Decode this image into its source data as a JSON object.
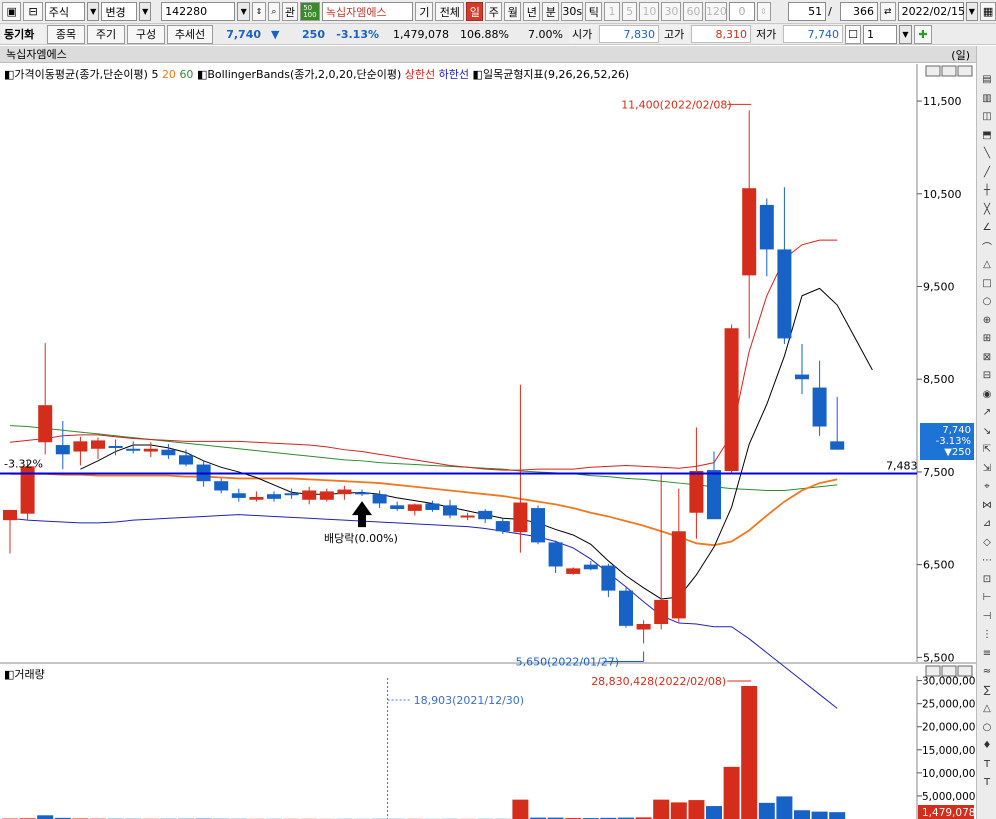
{
  "toolbar": {
    "market": "주식",
    "change": "변경",
    "code": "142280",
    "search_small": "관",
    "badge": "50\n100",
    "stock_name": "녹십자엠에스",
    "tab_gi": "기",
    "tab_all": "전체",
    "periods": [
      "일",
      "주",
      "월",
      "년",
      "분",
      "30s",
      "틱"
    ],
    "ticks": [
      "1",
      "5",
      "10",
      "30",
      "60",
      "120"
    ],
    "zero": "0",
    "count": "51",
    "slash": "/",
    "total": "366",
    "date": "2022/02/15"
  },
  "quote": {
    "sync": "동기화",
    "btn_item": "종목",
    "btn_period": "주기",
    "btn_compose": "구성",
    "btn_trend": "추세선",
    "price": "7,740",
    "change_arrow": "▼",
    "change": "250",
    "change_pct": "-3.13%",
    "volume": "1,479,078",
    "ratio": "106.88%",
    "turnover": "7.00%",
    "open_label": "시가",
    "open": "7,830",
    "high_label": "고가",
    "high": "8,310",
    "low_label": "저가",
    "low": "7,740",
    "panel_no": "1"
  },
  "title": {
    "name": "녹십자엠에스",
    "period": "(일)"
  },
  "price_legend": {
    "ma_label": "가격이동평균(종가,단순이평)",
    "ma5": "5",
    "ma20": "20",
    "ma60": "60",
    "bb_label": "BollingerBands(종가,2,0,20,단순이평)",
    "upper": "상한선",
    "lower": "하한선",
    "ichimoku": "일목균형지표(9,26,26,52,26)"
  },
  "volume_legend": {
    "label": "거래량"
  },
  "annotations": {
    "high": "11,400(2022/02/08)",
    "low": "5,650(2022/01/27)",
    "dividend": "배당락(0.00%)",
    "hline_pct": "-3.32%",
    "hline_value": "7,483",
    "vol_high": "28,830,428(2022/02/08)",
    "vol_mark": "18,903(2021/12/30)",
    "vol_last": "1,479,078"
  },
  "price_tag": {
    "price": "7,740",
    "pct": "-3.13%",
    "chg": "▼250"
  },
  "colors": {
    "up": "#d42d1b",
    "down": "#1762c7",
    "ma5": "#000000",
    "ma20": "#f07820",
    "ma60": "#2e8b2e",
    "bb_upper": "#d42020",
    "bb_lower": "#2020c0",
    "hline": "#0000dd"
  },
  "chart_data": [
    {
      "type": "candlestick",
      "title": "녹십자엠에스 (일)",
      "y_ticks": [
        "11,500",
        "10,500",
        "9,500",
        "8,500",
        "7,500",
        "6,500",
        "5,500"
      ],
      "ylim": [
        5450,
        11900
      ],
      "candles": [
        {
          "o": 6980,
          "h": 7050,
          "l": 6620,
          "c": 7090
        },
        {
          "o": 7050,
          "h": 7620,
          "l": 6980,
          "c": 7560
        },
        {
          "o": 7820,
          "h": 8890,
          "l": 7690,
          "c": 8220
        },
        {
          "o": 7790,
          "h": 8050,
          "l": 7530,
          "c": 7690
        },
        {
          "o": 7720,
          "h": 7880,
          "l": 7570,
          "c": 7830
        },
        {
          "o": 7750,
          "h": 7870,
          "l": 7640,
          "c": 7840
        },
        {
          "o": 7780,
          "h": 7850,
          "l": 7680,
          "c": 7770
        },
        {
          "o": 7750,
          "h": 7830,
          "l": 7700,
          "c": 7740
        },
        {
          "o": 7720,
          "h": 7820,
          "l": 7660,
          "c": 7750
        },
        {
          "o": 7740,
          "h": 7800,
          "l": 7640,
          "c": 7680
        },
        {
          "o": 7680,
          "h": 7740,
          "l": 7560,
          "c": 7580
        },
        {
          "o": 7580,
          "h": 7620,
          "l": 7340,
          "c": 7400
        },
        {
          "o": 7400,
          "h": 7430,
          "l": 7270,
          "c": 7300
        },
        {
          "o": 7270,
          "h": 7320,
          "l": 7180,
          "c": 7220
        },
        {
          "o": 7200,
          "h": 7290,
          "l": 7180,
          "c": 7230
        },
        {
          "o": 7260,
          "h": 7290,
          "l": 7180,
          "c": 7210
        },
        {
          "o": 7270,
          "h": 7320,
          "l": 7210,
          "c": 7250
        },
        {
          "o": 7200,
          "h": 7340,
          "l": 7150,
          "c": 7300
        },
        {
          "o": 7200,
          "h": 7320,
          "l": 7180,
          "c": 7290
        },
        {
          "o": 7260,
          "h": 7350,
          "l": 7200,
          "c": 7310
        },
        {
          "o": 7280,
          "h": 7310,
          "l": 7240,
          "c": 7260
        },
        {
          "o": 7260,
          "h": 7300,
          "l": 7110,
          "c": 7160
        },
        {
          "o": 7140,
          "h": 7180,
          "l": 7080,
          "c": 7100
        },
        {
          "o": 7080,
          "h": 7160,
          "l": 7030,
          "c": 7150
        },
        {
          "o": 7160,
          "h": 7190,
          "l": 7070,
          "c": 7090
        },
        {
          "o": 7140,
          "h": 7200,
          "l": 7000,
          "c": 7030
        },
        {
          "o": 7020,
          "h": 7060,
          "l": 6980,
          "c": 7030
        },
        {
          "o": 7080,
          "h": 7100,
          "l": 6950,
          "c": 6990
        },
        {
          "o": 6970,
          "h": 7000,
          "l": 6830,
          "c": 6860
        },
        {
          "o": 6850,
          "h": 8440,
          "l": 6630,
          "c": 7170
        },
        {
          "o": 7110,
          "h": 7140,
          "l": 6720,
          "c": 6740
        },
        {
          "o": 6740,
          "h": 6760,
          "l": 6410,
          "c": 6480
        },
        {
          "o": 6400,
          "h": 6470,
          "l": 6390,
          "c": 6460
        },
        {
          "o": 6500,
          "h": 6540,
          "l": 6440,
          "c": 6450
        },
        {
          "o": 6490,
          "h": 6510,
          "l": 6150,
          "c": 6220
        },
        {
          "o": 6220,
          "h": 6260,
          "l": 5820,
          "c": 5840
        },
        {
          "o": 5800,
          "h": 5900,
          "l": 5650,
          "c": 5860
        },
        {
          "o": 5860,
          "h": 7490,
          "l": 5800,
          "c": 6120
        },
        {
          "o": 5920,
          "h": 7320,
          "l": 5880,
          "c": 6860
        },
        {
          "o": 7060,
          "h": 7980,
          "l": 6780,
          "c": 7510
        },
        {
          "o": 7520,
          "h": 7720,
          "l": 7000,
          "c": 6990
        },
        {
          "o": 7510,
          "h": 9090,
          "l": 7490,
          "c": 9050
        },
        {
          "o": 9620,
          "h": 11400,
          "l": 8940,
          "c": 10560
        },
        {
          "o": 10380,
          "h": 10450,
          "l": 9610,
          "c": 9900
        },
        {
          "o": 9900,
          "h": 10570,
          "l": 8880,
          "c": 8940
        },
        {
          "o": 8550,
          "h": 8880,
          "l": 8340,
          "c": 8500
        },
        {
          "o": 8410,
          "h": 8700,
          "l": 7890,
          "c": 7990
        },
        {
          "o": 7830,
          "h": 8310,
          "l": 7740,
          "c": 7740
        }
      ],
      "ma5": [
        null,
        null,
        null,
        null,
        7530,
        7620,
        7720,
        7790,
        7790,
        7760,
        7710,
        7620,
        7550,
        7500,
        7440,
        7360,
        7280,
        7260,
        7260,
        7270,
        7280,
        7260,
        7220,
        7190,
        7160,
        7120,
        7080,
        7040,
        7000,
        6990,
        6950,
        6880,
        6820,
        6720,
        6540,
        6380,
        6250,
        6130,
        6150,
        6390,
        6690,
        7120,
        7800,
        8230,
        8750,
        9400,
        9480,
        9300,
        8950,
        8600
      ],
      "ma20": [
        7480,
        7480,
        7480,
        7470,
        7470,
        7460,
        7460,
        7460,
        7460,
        7460,
        7450,
        7450,
        7440,
        7430,
        7430,
        7430,
        7430,
        7420,
        7410,
        7400,
        7390,
        7380,
        7360,
        7340,
        7320,
        7300,
        7280,
        7260,
        7240,
        7210,
        7180,
        7150,
        7110,
        7060,
        7020,
        6970,
        6920,
        6860,
        6800,
        6730,
        6710,
        6750,
        6870,
        7030,
        7180,
        7300,
        7380,
        7420
      ],
      "ma60": [
        8000,
        7990,
        7970,
        7950,
        7930,
        7910,
        7890,
        7870,
        7850,
        7830,
        7810,
        7790,
        7770,
        7750,
        7730,
        7710,
        7690,
        7670,
        7650,
        7630,
        7620,
        7600,
        7590,
        7580,
        7570,
        7560,
        7550,
        7540,
        7530,
        7510,
        7500,
        7490,
        7480,
        7460,
        7450,
        7430,
        7420,
        7400,
        7380,
        7360,
        7340,
        7320,
        7310,
        7300,
        7300,
        7320,
        7340,
        7360
      ],
      "bb_upper": [
        7820,
        7840,
        7860,
        7890,
        7900,
        7900,
        7880,
        7860,
        7850,
        7840,
        7830,
        7830,
        7830,
        7830,
        7820,
        7810,
        7800,
        7790,
        7770,
        7740,
        7720,
        7690,
        7660,
        7630,
        7600,
        7570,
        7550,
        7530,
        7520,
        7520,
        7530,
        7530,
        7530,
        7550,
        7560,
        7570,
        7560,
        7550,
        7540,
        7560,
        7600,
        7900,
        8800,
        9400,
        9800,
        9950,
        10000,
        10000
      ],
      "bb_lower": [
        7000,
        6980,
        6970,
        6960,
        6950,
        6950,
        6960,
        6980,
        6990,
        7000,
        7010,
        7020,
        7030,
        7040,
        7030,
        7020,
        7010,
        7000,
        6990,
        6980,
        6970,
        6960,
        6950,
        6940,
        6930,
        6920,
        6910,
        6890,
        6860,
        6830,
        6800,
        6750,
        6680,
        6560,
        6410,
        6260,
        6100,
        5950,
        5870,
        5860,
        5830,
        5830,
        5700,
        5550,
        5400,
        5250,
        5100,
        4950
      ]
    },
    {
      "type": "bar",
      "title": "거래량",
      "y_ticks": [
        "30,000,000",
        "25,000,000",
        "20,000,000",
        "15,000,000",
        "10,000,000",
        "5,000,000"
      ],
      "ylim": [
        0,
        31000000
      ],
      "values": [
        100000,
        150000,
        800000,
        250000,
        120000,
        80000,
        70000,
        60000,
        50000,
        60000,
        70000,
        90000,
        60000,
        50000,
        40000,
        40000,
        40000,
        40000,
        30000,
        40000,
        30000,
        50000,
        40000,
        40000,
        30000,
        40000,
        30000,
        40000,
        40000,
        4200000,
        300000,
        300000,
        200000,
        200000,
        250000,
        300000,
        350000,
        4200000,
        3600000,
        4100000,
        2800000,
        11300000,
        28830428,
        3500000,
        4900000,
        1900000,
        1600000,
        1479078
      ],
      "up": [
        1,
        1,
        0,
        0,
        1,
        1,
        0,
        0,
        1,
        0,
        0,
        0,
        0,
        0,
        1,
        0,
        1,
        1,
        1,
        0,
        0,
        0,
        0,
        1,
        0,
        0,
        1,
        0,
        0,
        1,
        0,
        0,
        1,
        0,
        0,
        0,
        1,
        1,
        1,
        1,
        0,
        1,
        1,
        0,
        0,
        0,
        0,
        0
      ]
    }
  ]
}
